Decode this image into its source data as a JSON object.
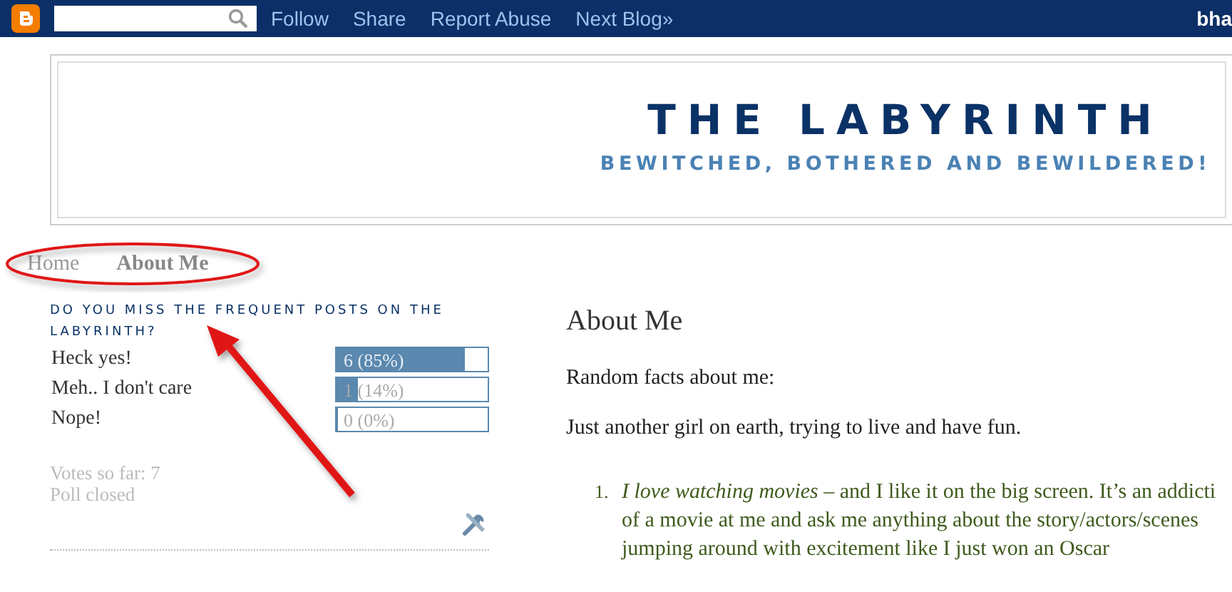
{
  "navbar": {
    "links": [
      "Follow",
      "Share",
      "Report Abuse",
      "Next Blog»"
    ],
    "user": "bha"
  },
  "header": {
    "title": "THE LABYRINTH",
    "subtitle": "BEWITCHED, BOTHERED AND BEWILDERED!"
  },
  "tabs": [
    {
      "label": "Home",
      "selected": false
    },
    {
      "label": "About Me",
      "selected": true
    }
  ],
  "poll": {
    "question": "DO YOU MISS THE FREQUENT POSTS ON THE LABYRINTH?",
    "options": [
      {
        "label": "Heck yes!",
        "result": "6 (85%)",
        "level": 0.85
      },
      {
        "label": "Meh.. I don't care",
        "result": "1 (14%)",
        "level": 0.14
      },
      {
        "label": "Nope!",
        "result": "0 (0%)",
        "level": 0
      }
    ],
    "votes": "Votes so far: 7",
    "status": "Poll closed"
  },
  "post": {
    "title": "About Me",
    "paragraphs": [
      "Random facts about me:",
      "Just another girl on earth, trying to live and have fun."
    ],
    "list": [
      {
        "number": "1.",
        "lines": [
          "*I love watching movies* – and I like it on the big screen. It’s an addicti",
          "of a movie at me and ask me anything about the story/actors/scenes",
          "jumping around with excitement like I just won an Oscar"
        ]
      }
    ]
  }
}
